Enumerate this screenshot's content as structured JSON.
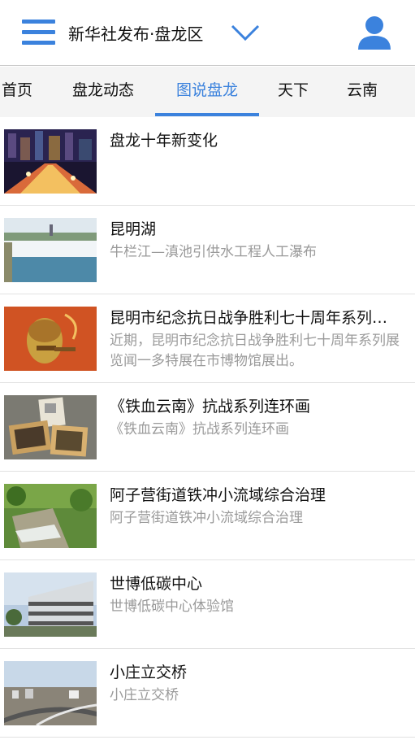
{
  "header": {
    "title": "新华社发布·盘龙区",
    "menu_icon": "menu-icon",
    "dropdown_icon": "chevron-down-icon",
    "user_icon": "user-icon",
    "accent_color": "#3b82dd"
  },
  "tabs": [
    {
      "label": "首页",
      "active": false
    },
    {
      "label": "盘龙动态",
      "active": false
    },
    {
      "label": "图说盘龙",
      "active": true
    },
    {
      "label": "天下",
      "active": false
    },
    {
      "label": "云南",
      "active": false
    }
  ],
  "articles": [
    {
      "title": "盘龙十年新变化",
      "summary": ""
    },
    {
      "title": "昆明湖",
      "summary": "牛栏江—滇池引供水工程人工瀑布"
    },
    {
      "title": "昆明市纪念抗日战争胜利七十周年系列展览闻一多特展在市博物馆展出",
      "summary": "近期，昆明市纪念抗日战争胜利七十周年系列展览闻一多特展在市博物馆展出。"
    },
    {
      "title": "《铁血云南》抗战系列连环画",
      "summary": "《铁血云南》抗战系列连环画"
    },
    {
      "title": "阿子营街道铁冲小流域综合治理",
      "summary": "阿子营街道铁冲小流域综合治理"
    },
    {
      "title": "世博低碳中心",
      "summary": "世博低碳中心体验馆"
    },
    {
      "title": "小庄立交桥",
      "summary": "小庄立交桥"
    }
  ]
}
